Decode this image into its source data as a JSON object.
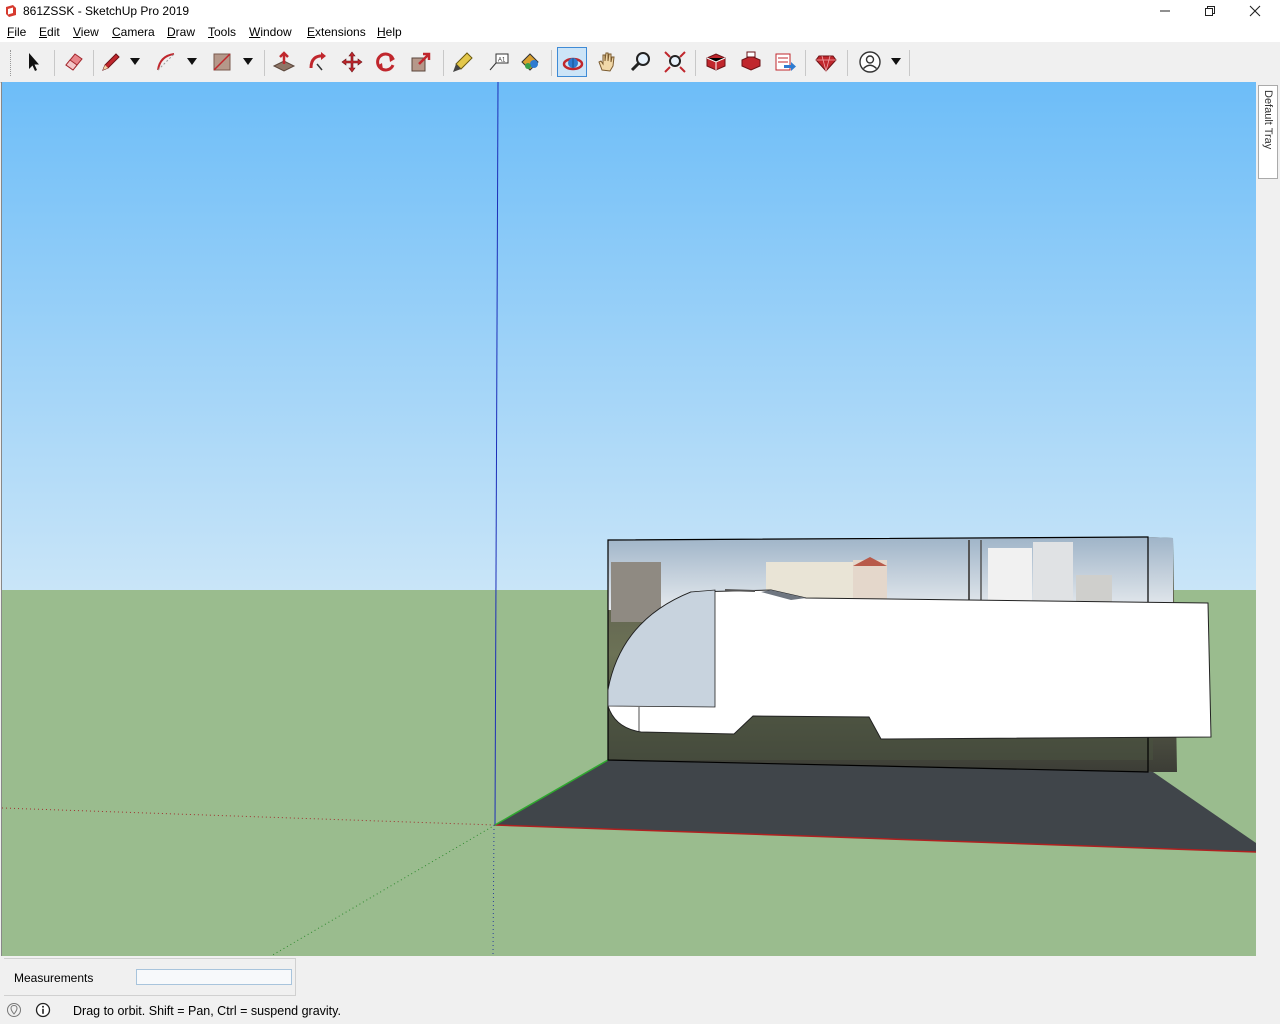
{
  "window": {
    "title": "861ZSSK - SketchUp Pro 2019",
    "controls": [
      "minimize",
      "restore",
      "close"
    ]
  },
  "menu": {
    "items": [
      {
        "label": "File",
        "u": "F",
        "rest": "ile"
      },
      {
        "label": "Edit",
        "u": "E",
        "rest": "dit"
      },
      {
        "label": "View",
        "u": "V",
        "rest": "iew"
      },
      {
        "label": "Camera",
        "u": "C",
        "rest": "amera"
      },
      {
        "label": "Draw",
        "u": "D",
        "rest": "raw"
      },
      {
        "label": "Tools",
        "u": "T",
        "rest": "ools"
      },
      {
        "label": "Window",
        "u": "W",
        "rest": "indow"
      },
      {
        "label": "Extensions",
        "u": "E",
        "rest": "xtensions"
      },
      {
        "label": "Help",
        "u": "H",
        "rest": "elp"
      }
    ]
  },
  "toolbar": {
    "tools": [
      "select-icon",
      "eraser-icon",
      "pencil-line-icon",
      "arc-icon",
      "rectangle-icon",
      "push-pull-icon",
      "follow-me-icon",
      "move-icon",
      "rotate-icon",
      "scale-icon",
      "tape-measure-icon",
      "text-icon",
      "paint-bucket-icon",
      "orbit-icon",
      "pan-icon",
      "zoom-icon",
      "zoom-extents-icon",
      "3d-warehouse-icon",
      "extension-warehouse-icon",
      "send-to-layout-icon",
      "extension-manager-icon",
      "account-icon"
    ],
    "active_tool": "orbit-icon"
  },
  "tray": {
    "label": "Default Tray"
  },
  "measurements": {
    "label": "Measurements",
    "value": ""
  },
  "status": {
    "message": "Drag to orbit. Shift = Pan, Ctrl = suspend gravity."
  },
  "colors": {
    "sky_top": "#6dbdf8",
    "sky_bottom": "#c9e5f8",
    "ground": "#9abc8e",
    "plane": "#40454a",
    "accent": "#c0272d"
  }
}
